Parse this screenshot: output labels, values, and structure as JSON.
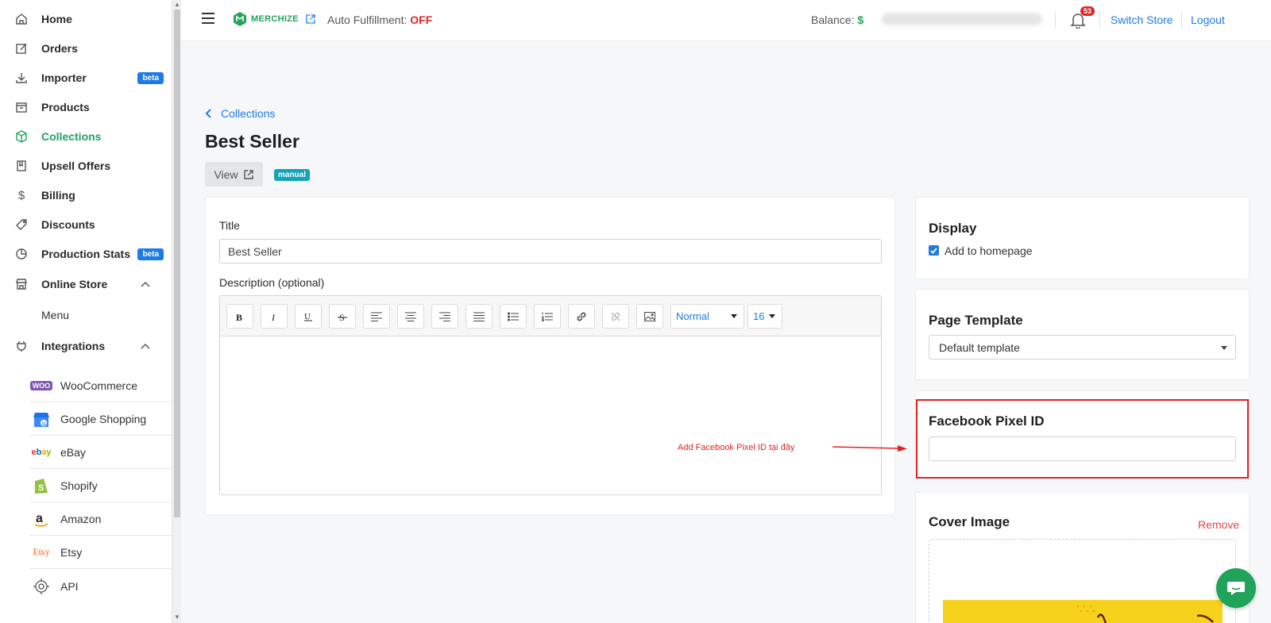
{
  "sidebar": {
    "nav": [
      {
        "label": "Home",
        "icon": "home-icon"
      },
      {
        "label": "Orders",
        "icon": "edit-icon"
      },
      {
        "label": "Importer",
        "icon": "download-icon",
        "badge": "beta"
      },
      {
        "label": "Products",
        "icon": "box-icon"
      },
      {
        "label": "Collections",
        "icon": "cube-icon",
        "active": true
      },
      {
        "label": "Upsell Offers",
        "icon": "book-icon"
      },
      {
        "label": "Billing",
        "icon": "dollar-icon"
      },
      {
        "label": "Discounts",
        "icon": "tag-icon"
      },
      {
        "label": "Production Stats",
        "icon": "pie-chart-icon",
        "badge": "beta"
      },
      {
        "label": "Online Store",
        "icon": "store-icon"
      },
      {
        "label": "Integrations",
        "icon": "plug-icon"
      }
    ],
    "online_store_sub": "Menu",
    "integrations": [
      {
        "label": "WooCommerce",
        "logo": "WOO"
      },
      {
        "label": "Google Shopping",
        "logo": "G"
      },
      {
        "label": "eBay",
        "logo": "ebay"
      },
      {
        "label": "Shopify",
        "logo": "S"
      },
      {
        "label": "Amazon",
        "logo": "a"
      },
      {
        "label": "Etsy",
        "logo": "Etsy"
      },
      {
        "label": "API",
        "logo": "API"
      }
    ]
  },
  "header": {
    "brand": "MERCHIZE",
    "auto_fulfillment_label": "Auto Fulfillment:",
    "auto_fulfillment_value": "OFF",
    "balance_label": "Balance:",
    "balance_currency": "$",
    "notifications_count": "53",
    "switch_store": "Switch Store",
    "logout": "Logout"
  },
  "breadcrumb": "Collections",
  "page_title": "Best Seller",
  "view_button": "View",
  "type_badge": "manual",
  "form": {
    "title_label": "Title",
    "title_value": "Best Seller",
    "description_label": "Description (optional)",
    "heading_select": "Normal",
    "size_select": "16"
  },
  "display": {
    "title": "Display",
    "add_to_homepage": "Add to homepage"
  },
  "page_template": {
    "title": "Page Template",
    "value": "Default template"
  },
  "facebook_pixel": {
    "title": "Facebook Pixel ID",
    "value": "",
    "annotation": "Add Facebook Pixel ID tại đây"
  },
  "cover_image": {
    "title": "Cover Image",
    "remove": "Remove"
  },
  "colors": {
    "accent": "#20a35a",
    "link": "#1e7be6",
    "danger": "#e02424",
    "badge": "#17a2b8"
  }
}
